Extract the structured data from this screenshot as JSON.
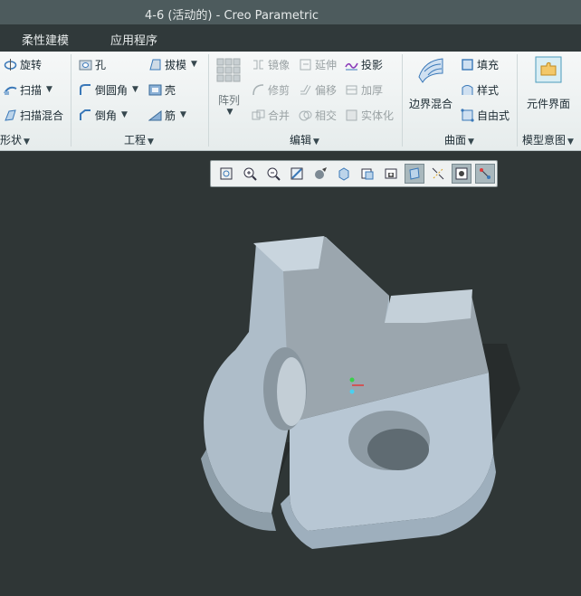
{
  "window": {
    "title": "4-6 (活动的) - Creo Parametric"
  },
  "menu": {
    "tabs": [
      "柔性建模",
      "应用程序"
    ]
  },
  "ribbon": {
    "shape": {
      "items": [
        "旋转",
        "扫描",
        "扫描混合"
      ],
      "label": "形状"
    },
    "engineering": {
      "items": [
        "孔",
        "拔模",
        "倒圆角",
        "壳",
        "倒角",
        "筋"
      ],
      "label": "工程"
    },
    "edit": {
      "pattern": "阵列",
      "items": [
        "镜像",
        "延伸",
        "投影",
        "修剪",
        "偏移",
        "加厚",
        "合并",
        "相交",
        "实体化"
      ],
      "label": "编辑"
    },
    "surfaces": {
      "boundary": "边界混合",
      "items": [
        "填充",
        "样式",
        "自由式"
      ],
      "label": "曲面"
    },
    "model_intent": {
      "component": "元件界面",
      "label": "模型意图"
    }
  },
  "view_toolbar": {
    "icons": [
      "refit-icon",
      "zoom-in-icon",
      "zoom-out-icon",
      "repaint-icon",
      "display-style-icon",
      "saved-views-icon",
      "view-manager-icon",
      "perspective-icon",
      "datum-display-icon",
      "spin-center-icon",
      "annotation-display-icon",
      "axis-display-icon"
    ]
  },
  "colors": {
    "background": "#2f3636",
    "part": "#b9c6d1",
    "accent": "#2a7bc2"
  }
}
